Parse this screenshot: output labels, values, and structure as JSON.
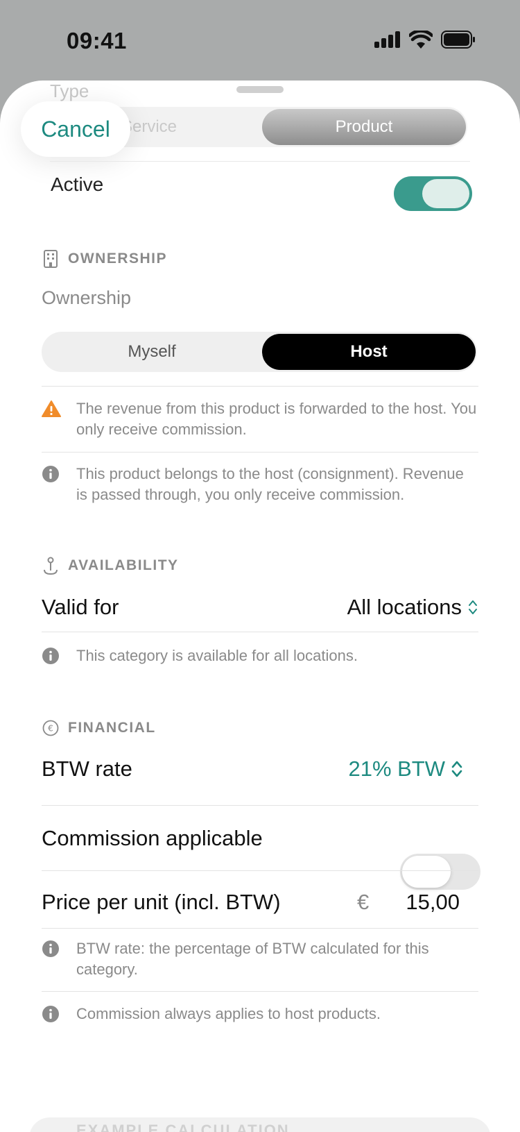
{
  "status_bar": {
    "time": "09:41",
    "icons": [
      "cellular-signal-icon",
      "wifi-icon",
      "battery-icon"
    ]
  },
  "header": {
    "cancel_label": "Cancel"
  },
  "type": {
    "label": "Type",
    "options": [
      "Service",
      "Product"
    ],
    "selected": "Product"
  },
  "active": {
    "label": "Active",
    "value": true
  },
  "ownership": {
    "section_title": "OWNERSHIP",
    "field_label": "Ownership",
    "options": [
      "Myself",
      "Host"
    ],
    "selected": "Host",
    "warning_note": "The revenue from this product is forwarded to the host. You only receive commission.",
    "info_note": "This product belongs to the host (consignment). Revenue is passed through, you only receive commission."
  },
  "availability": {
    "section_title": "AVAILABILITY",
    "valid_for_label": "Valid for",
    "valid_for_value": "All locations",
    "info_note": "This category is available for all locations."
  },
  "financial": {
    "section_title": "FINANCIAL",
    "btw_label": "BTW rate",
    "btw_value": "21% BTW",
    "commission_label": "Commission applicable",
    "commission_value": false,
    "price_label": "Price per unit (incl. BTW)",
    "currency_symbol": "€",
    "price_value": "15,00",
    "btw_note": "BTW rate: the percentage of BTW calculated for this category.",
    "commission_note": "Commission always applies to host products."
  },
  "next_section_peek": "EXAMPLE CALCULATION",
  "colors": {
    "accent": "#1d8a80",
    "toggle_on": "#3a9b8d",
    "warning": "#f08c2b",
    "muted_text": "#8a8a8a"
  }
}
